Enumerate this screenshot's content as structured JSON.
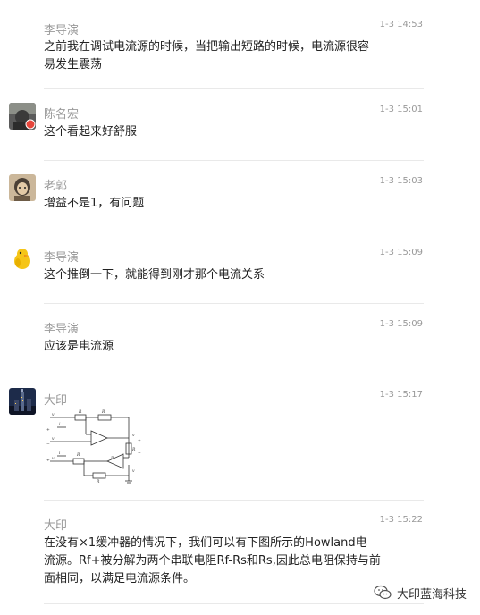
{
  "messages": [
    {
      "name": "李导演",
      "time": "1-3 14:53",
      "lines": [
        "之前我在调试电流源的时候，当把输出短路的时候，电流源很容",
        "易发生震荡"
      ],
      "avatar": "none"
    },
    {
      "name": "陈名宏",
      "time": "1-3 15:01",
      "lines": [
        "这个看起来好舒服"
      ],
      "avatar": "avatar-photo"
    },
    {
      "name": "老郭",
      "time": "1-3 15:03",
      "lines": [
        "增益不是1，有问题"
      ],
      "avatar": "avatar-portrait"
    },
    {
      "name": "李导演",
      "time": "1-3 15:09",
      "lines": [
        "这个推倒一下，就能得到刚才那个电流关系"
      ],
      "avatar": "avatar-duck"
    },
    {
      "name": "李导演",
      "time": "1-3 15:09",
      "lines": [
        "应该是电流源"
      ],
      "avatar": "none"
    },
    {
      "name": "大印",
      "time": "1-3 15:17",
      "lines": [],
      "avatar": "avatar-city",
      "attachment": "circuit-image"
    },
    {
      "name": "大印",
      "time": "1-3 15:22",
      "lines": [
        "在没有×1缓冲器的情况下，我们可以有下图所示的Howland电",
        "流源。Rf+被分解为两个串联电阻Rf-Rs和Rs,因此总电阻保持与前",
        "面相同，以满足电流源条件。"
      ],
      "avatar": "none"
    }
  ],
  "circuit": {
    "labels": [
      "R",
      "R",
      "R",
      "R",
      "v",
      "v",
      "v",
      "v",
      "R",
      "R",
      "i",
      "i",
      "v",
      "+",
      "−",
      "+",
      "−",
      "+"
    ]
  },
  "watermark": {
    "text": "大印蓝海科技",
    "icon": "wechat-icon"
  }
}
